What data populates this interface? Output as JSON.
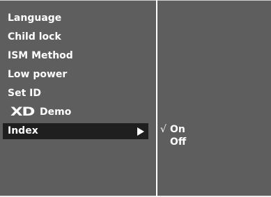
{
  "menu": {
    "items": [
      {
        "label": "Language"
      },
      {
        "label": "Child lock"
      },
      {
        "label": "ISM Method"
      },
      {
        "label": "Low power"
      },
      {
        "label": "Set ID"
      },
      {
        "label": "Demo",
        "logo": "XD"
      },
      {
        "label": "Index",
        "selected": true,
        "icon": "arrow-right-icon"
      }
    ]
  },
  "submenu": {
    "options": [
      {
        "mark": "√",
        "label": "On",
        "checked": true
      },
      {
        "mark": "",
        "label": "Off",
        "checked": false
      }
    ]
  },
  "colors": {
    "panel": "#5e5e5e",
    "highlight": "#1f1f1f",
    "text": "#ffffff",
    "background": "#ffffff"
  }
}
